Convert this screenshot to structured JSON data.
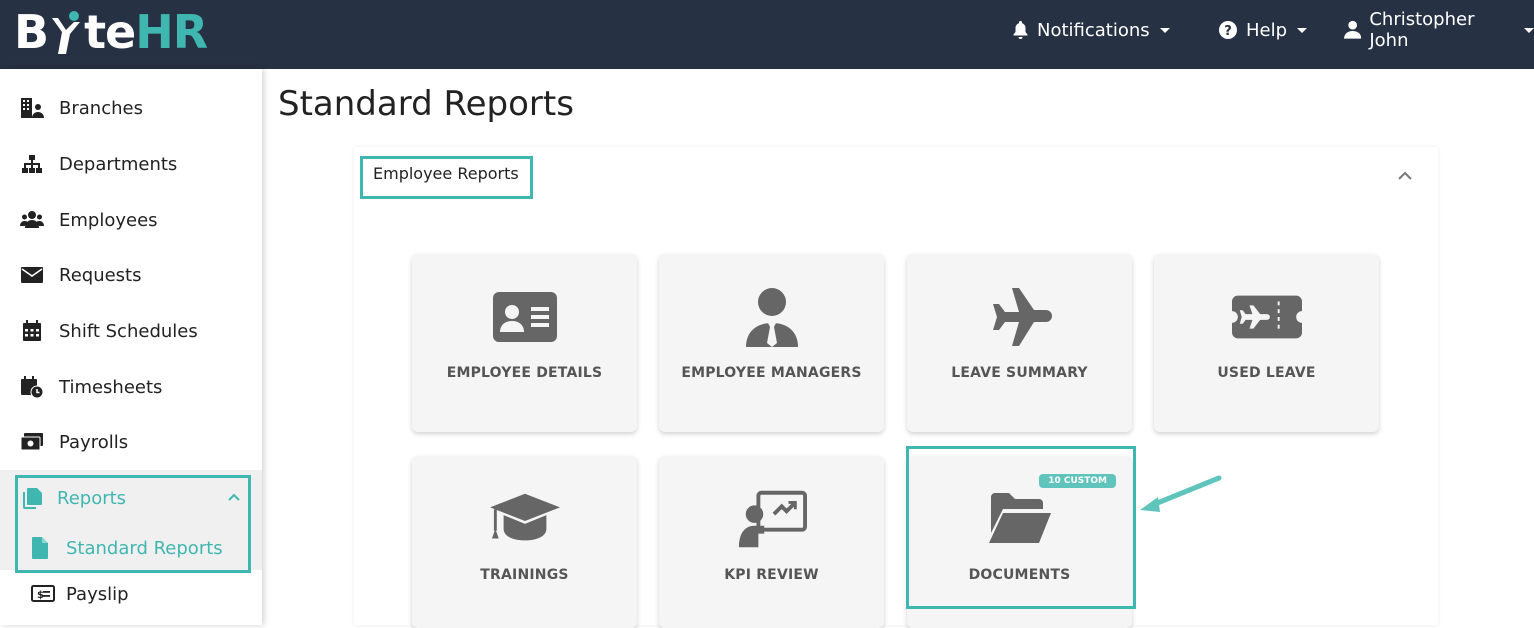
{
  "app": {
    "logo_prefix": "B",
    "logo_mid": "te",
    "logo_suffix": "HR"
  },
  "topnav": {
    "notifications": "Notifications",
    "help": "Help",
    "user": "Christopher John"
  },
  "sidebar": {
    "items": [
      {
        "label": "Branches",
        "icon": "building-icon"
      },
      {
        "label": "Departments",
        "icon": "sitemap-icon"
      },
      {
        "label": "Employees",
        "icon": "users-icon"
      },
      {
        "label": "Requests",
        "icon": "envelope-icon"
      },
      {
        "label": "Shift Schedules",
        "icon": "calendar-icon"
      },
      {
        "label": "Timesheets",
        "icon": "calendar-clock-icon"
      },
      {
        "label": "Payrolls",
        "icon": "money-icon"
      },
      {
        "label": "Reports",
        "icon": "copy-icon"
      },
      {
        "label": "Standard Reports",
        "icon": "file-icon"
      },
      {
        "label": "Payslip",
        "icon": "receipt-icon"
      }
    ]
  },
  "main": {
    "title": "Standard Reports",
    "section_title": "Employee Reports",
    "tiles": [
      {
        "label": "EMPLOYEE DETAILS",
        "icon": "id-card-icon"
      },
      {
        "label": "EMPLOYEE MANAGERS",
        "icon": "user-tie-icon"
      },
      {
        "label": "LEAVE SUMMARY",
        "icon": "plane-icon"
      },
      {
        "label": "USED LEAVE",
        "icon": "plane-ticket-icon"
      },
      {
        "label": "TRAININGS",
        "icon": "graduation-cap-icon"
      },
      {
        "label": "KPI REVIEW",
        "icon": "chalkboard-teacher-icon"
      },
      {
        "label": "DOCUMENTS",
        "icon": "folder-open-icon",
        "badge": "10 CUSTOM"
      }
    ]
  },
  "colors": {
    "topbar": "#263143",
    "accent": "#3fb7b0",
    "tile_bg": "#f5f5f5",
    "tile_icon": "#666666"
  }
}
